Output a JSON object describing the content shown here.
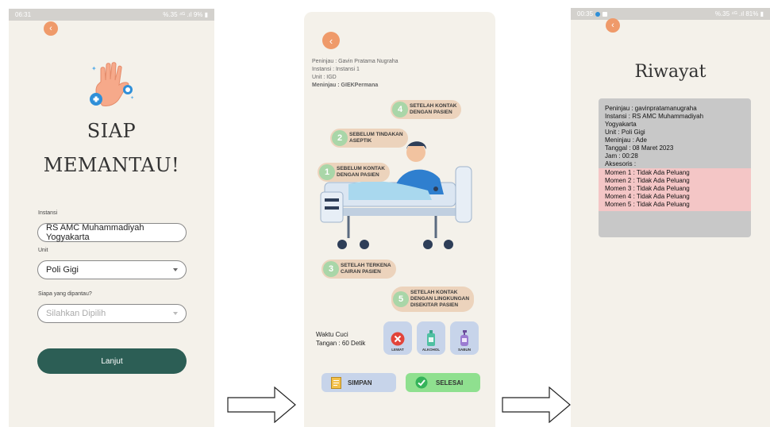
{
  "screen1": {
    "status_time": "06:31",
    "status_right": "%.35 ⁴ᴳ .ıl 9% ▮",
    "title_line1": "SIAP",
    "title_line2": "MEMANTAU!",
    "instansi_label": "Instansi",
    "instansi_value": "RS AMC Muhammadiyah Yogyakarta",
    "unit_label": "Unit",
    "unit_value": "Poli Gigi",
    "siapa_label": "Siapa yang dipantau?",
    "siapa_placeholder": "Silahkan Dipilih",
    "lanjut_label": "Lanjut"
  },
  "screen2": {
    "peninjau": "Peninjau : Gavin Pratama Nugraha",
    "instansi": "Instansi : Instansi 1",
    "unit": "Unit : IGD",
    "meninjau": "Meninjau : GIEKPermana",
    "moments": [
      {
        "num": "4",
        "text1": "SETELAH KONTAK",
        "text2": "DENGAN PASIEN",
        "text3": ""
      },
      {
        "num": "2",
        "text1": "SEBELUM TINDAKAN",
        "text2": "ASEPTIK",
        "text3": ""
      },
      {
        "num": "1",
        "text1": "SEBELUM KONTAK",
        "text2": "DENGAN PASIEN",
        "text3": ""
      },
      {
        "num": "3",
        "text1": "SETELAH TERKENA",
        "text2": "CAIRAN PASIEN",
        "text3": ""
      },
      {
        "num": "5",
        "text1": "SETELAH KONTAK",
        "text2": "DENGAN LINGKUNGAN",
        "text3": "DISEKITAR PASIEN"
      }
    ],
    "waktu_line1": "Waktu Cuci",
    "waktu_line2": "Tangan : 60 Detik",
    "tiles": [
      {
        "label": "LEWAT",
        "icon": "x-circle-icon"
      },
      {
        "label": "ALKOHOL",
        "icon": "alcohol-bottle-icon"
      },
      {
        "label": "SABUN",
        "icon": "soap-bottle-icon"
      }
    ],
    "simpan_label": "SIMPAN",
    "selesai_label": "SELESAI"
  },
  "screen3": {
    "status_time": "00:35",
    "status_right": "%.35 ⁴ᴳ .ıl 81% ▮",
    "title": "Riwayat",
    "lines": [
      "Peninjau : gavinpratamanugraha",
      "Instansi : RS AMC Muhammadiyah",
      "Yogyakarta",
      "Unit : Poli Gigi",
      "Meninjau : Ade",
      "Tanggal : 08 Maret 2023",
      "Jam : 00:28",
      "Aksesoris :"
    ],
    "momen_lines": [
      "Momen 1 : Tidak Ada Peluang",
      "Momen 2 : Tidak Ada Peluang",
      "Momen 3 : Tidak Ada Peluang",
      "Momen 4 : Tidak Ada Peluang",
      "Momen 5 : Tidak Ada Peluang"
    ]
  },
  "colors": {
    "accent_orange": "#ef9a6a",
    "primary_green": "#2c5e55",
    "moment_pill": "#ecd3bc",
    "moment_number": "#a9d6a8",
    "momen_highlight": "#f4c6c6"
  }
}
